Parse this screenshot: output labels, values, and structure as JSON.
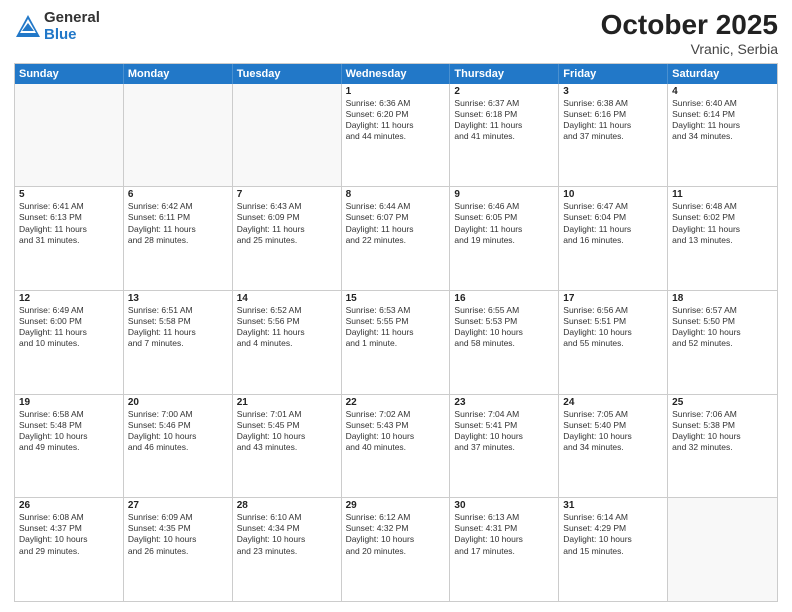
{
  "logo": {
    "general": "General",
    "blue": "Blue"
  },
  "title": {
    "month": "October 2025",
    "location": "Vranic, Serbia"
  },
  "weekdays": [
    "Sunday",
    "Monday",
    "Tuesday",
    "Wednesday",
    "Thursday",
    "Friday",
    "Saturday"
  ],
  "rows": [
    [
      {
        "day": "",
        "lines": []
      },
      {
        "day": "",
        "lines": []
      },
      {
        "day": "",
        "lines": []
      },
      {
        "day": "1",
        "lines": [
          "Sunrise: 6:36 AM",
          "Sunset: 6:20 PM",
          "Daylight: 11 hours",
          "and 44 minutes."
        ]
      },
      {
        "day": "2",
        "lines": [
          "Sunrise: 6:37 AM",
          "Sunset: 6:18 PM",
          "Daylight: 11 hours",
          "and 41 minutes."
        ]
      },
      {
        "day": "3",
        "lines": [
          "Sunrise: 6:38 AM",
          "Sunset: 6:16 PM",
          "Daylight: 11 hours",
          "and 37 minutes."
        ]
      },
      {
        "day": "4",
        "lines": [
          "Sunrise: 6:40 AM",
          "Sunset: 6:14 PM",
          "Daylight: 11 hours",
          "and 34 minutes."
        ]
      }
    ],
    [
      {
        "day": "5",
        "lines": [
          "Sunrise: 6:41 AM",
          "Sunset: 6:13 PM",
          "Daylight: 11 hours",
          "and 31 minutes."
        ]
      },
      {
        "day": "6",
        "lines": [
          "Sunrise: 6:42 AM",
          "Sunset: 6:11 PM",
          "Daylight: 11 hours",
          "and 28 minutes."
        ]
      },
      {
        "day": "7",
        "lines": [
          "Sunrise: 6:43 AM",
          "Sunset: 6:09 PM",
          "Daylight: 11 hours",
          "and 25 minutes."
        ]
      },
      {
        "day": "8",
        "lines": [
          "Sunrise: 6:44 AM",
          "Sunset: 6:07 PM",
          "Daylight: 11 hours",
          "and 22 minutes."
        ]
      },
      {
        "day": "9",
        "lines": [
          "Sunrise: 6:46 AM",
          "Sunset: 6:05 PM",
          "Daylight: 11 hours",
          "and 19 minutes."
        ]
      },
      {
        "day": "10",
        "lines": [
          "Sunrise: 6:47 AM",
          "Sunset: 6:04 PM",
          "Daylight: 11 hours",
          "and 16 minutes."
        ]
      },
      {
        "day": "11",
        "lines": [
          "Sunrise: 6:48 AM",
          "Sunset: 6:02 PM",
          "Daylight: 11 hours",
          "and 13 minutes."
        ]
      }
    ],
    [
      {
        "day": "12",
        "lines": [
          "Sunrise: 6:49 AM",
          "Sunset: 6:00 PM",
          "Daylight: 11 hours",
          "and 10 minutes."
        ]
      },
      {
        "day": "13",
        "lines": [
          "Sunrise: 6:51 AM",
          "Sunset: 5:58 PM",
          "Daylight: 11 hours",
          "and 7 minutes."
        ]
      },
      {
        "day": "14",
        "lines": [
          "Sunrise: 6:52 AM",
          "Sunset: 5:56 PM",
          "Daylight: 11 hours",
          "and 4 minutes."
        ]
      },
      {
        "day": "15",
        "lines": [
          "Sunrise: 6:53 AM",
          "Sunset: 5:55 PM",
          "Daylight: 11 hours",
          "and 1 minute."
        ]
      },
      {
        "day": "16",
        "lines": [
          "Sunrise: 6:55 AM",
          "Sunset: 5:53 PM",
          "Daylight: 10 hours",
          "and 58 minutes."
        ]
      },
      {
        "day": "17",
        "lines": [
          "Sunrise: 6:56 AM",
          "Sunset: 5:51 PM",
          "Daylight: 10 hours",
          "and 55 minutes."
        ]
      },
      {
        "day": "18",
        "lines": [
          "Sunrise: 6:57 AM",
          "Sunset: 5:50 PM",
          "Daylight: 10 hours",
          "and 52 minutes."
        ]
      }
    ],
    [
      {
        "day": "19",
        "lines": [
          "Sunrise: 6:58 AM",
          "Sunset: 5:48 PM",
          "Daylight: 10 hours",
          "and 49 minutes."
        ]
      },
      {
        "day": "20",
        "lines": [
          "Sunrise: 7:00 AM",
          "Sunset: 5:46 PM",
          "Daylight: 10 hours",
          "and 46 minutes."
        ]
      },
      {
        "day": "21",
        "lines": [
          "Sunrise: 7:01 AM",
          "Sunset: 5:45 PM",
          "Daylight: 10 hours",
          "and 43 minutes."
        ]
      },
      {
        "day": "22",
        "lines": [
          "Sunrise: 7:02 AM",
          "Sunset: 5:43 PM",
          "Daylight: 10 hours",
          "and 40 minutes."
        ]
      },
      {
        "day": "23",
        "lines": [
          "Sunrise: 7:04 AM",
          "Sunset: 5:41 PM",
          "Daylight: 10 hours",
          "and 37 minutes."
        ]
      },
      {
        "day": "24",
        "lines": [
          "Sunrise: 7:05 AM",
          "Sunset: 5:40 PM",
          "Daylight: 10 hours",
          "and 34 minutes."
        ]
      },
      {
        "day": "25",
        "lines": [
          "Sunrise: 7:06 AM",
          "Sunset: 5:38 PM",
          "Daylight: 10 hours",
          "and 32 minutes."
        ]
      }
    ],
    [
      {
        "day": "26",
        "lines": [
          "Sunrise: 6:08 AM",
          "Sunset: 4:37 PM",
          "Daylight: 10 hours",
          "and 29 minutes."
        ]
      },
      {
        "day": "27",
        "lines": [
          "Sunrise: 6:09 AM",
          "Sunset: 4:35 PM",
          "Daylight: 10 hours",
          "and 26 minutes."
        ]
      },
      {
        "day": "28",
        "lines": [
          "Sunrise: 6:10 AM",
          "Sunset: 4:34 PM",
          "Daylight: 10 hours",
          "and 23 minutes."
        ]
      },
      {
        "day": "29",
        "lines": [
          "Sunrise: 6:12 AM",
          "Sunset: 4:32 PM",
          "Daylight: 10 hours",
          "and 20 minutes."
        ]
      },
      {
        "day": "30",
        "lines": [
          "Sunrise: 6:13 AM",
          "Sunset: 4:31 PM",
          "Daylight: 10 hours",
          "and 17 minutes."
        ]
      },
      {
        "day": "31",
        "lines": [
          "Sunrise: 6:14 AM",
          "Sunset: 4:29 PM",
          "Daylight: 10 hours",
          "and 15 minutes."
        ]
      },
      {
        "day": "",
        "lines": []
      }
    ]
  ]
}
